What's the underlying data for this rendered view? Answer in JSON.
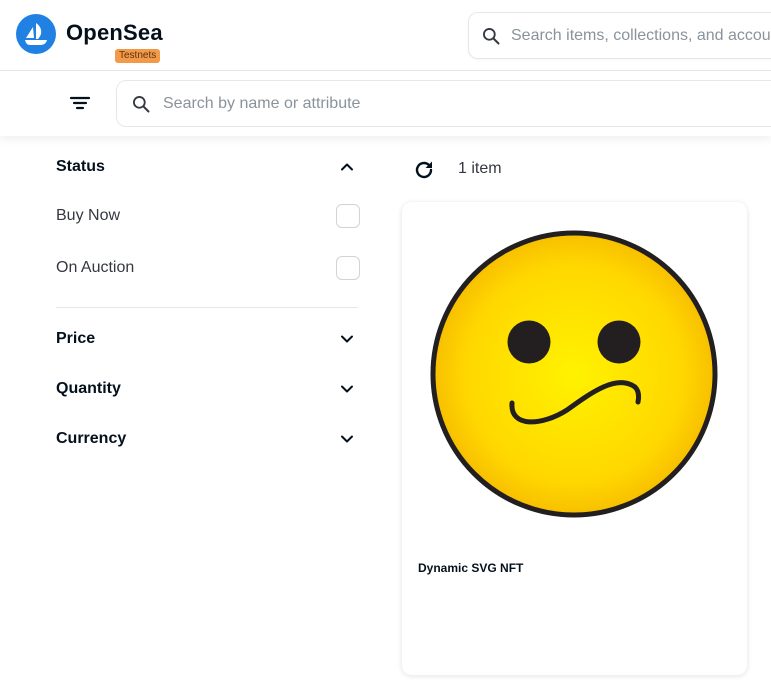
{
  "header": {
    "brand": "OpenSea",
    "badge": "Testnets",
    "search_placeholder": "Search items, collections, and accounts",
    "brand_color": "#2081e2",
    "badge_color": "#f2994a"
  },
  "filterbar": {
    "search_placeholder": "Search by name or attribute"
  },
  "sidebar": {
    "status": {
      "title": "Status",
      "expanded": true,
      "options": [
        {
          "label": "Buy Now",
          "checked": false
        },
        {
          "label": "On Auction",
          "checked": false
        }
      ]
    },
    "sections": [
      {
        "title": "Price",
        "expanded": false
      },
      {
        "title": "Quantity",
        "expanded": false
      },
      {
        "title": "Currency",
        "expanded": false
      }
    ]
  },
  "results": {
    "count_label": "1 item",
    "items": [
      {
        "name": "Dynamic SVG NFT",
        "image": "yellow-wavy-mouth-smiley"
      }
    ]
  }
}
